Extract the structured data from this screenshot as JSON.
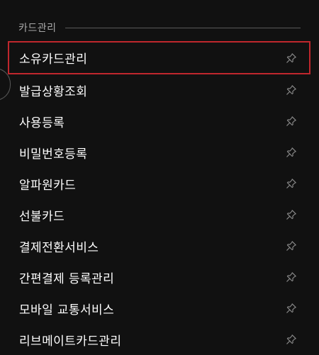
{
  "section": {
    "title": "카드관리"
  },
  "menu": {
    "items": [
      {
        "label": "소유카드관리",
        "icon": "pin-icon",
        "selected": true
      },
      {
        "label": "발급상황조회",
        "icon": "pin-icon"
      },
      {
        "label": "사용등록",
        "icon": "pin-icon"
      },
      {
        "label": "비밀번호등록",
        "icon": "pin-icon"
      },
      {
        "label": "알파원카드",
        "icon": "pin-icon"
      },
      {
        "label": "선불카드",
        "icon": "pin-icon"
      },
      {
        "label": "결제전환서비스",
        "icon": "pin-icon"
      },
      {
        "label": "간편결제 등록관리",
        "icon": "pin-icon"
      },
      {
        "label": "모바일 교통서비스",
        "icon": "pin-icon"
      },
      {
        "label": "리브메이트카드관리",
        "icon": "pin-icon"
      }
    ]
  },
  "colors": {
    "background": "#111111",
    "highlight_border": "#c0272d",
    "section_title": "#a8a8a8",
    "divider": "#5a5a5a",
    "pin_icon": "#8a8a8a"
  }
}
